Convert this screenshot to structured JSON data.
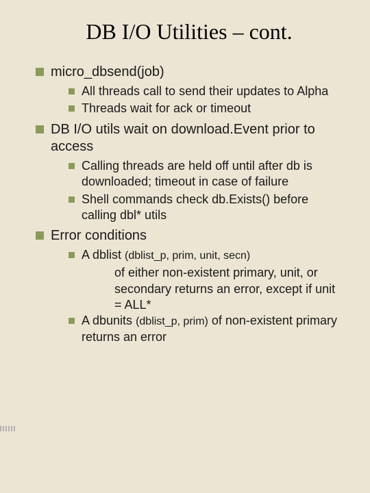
{
  "title": "DB I/O Utilities – cont.",
  "items": [
    {
      "text": "micro_dbsend(job)",
      "sub": [
        {
          "text": "All threads call to send their updates to Alpha"
        },
        {
          "text": "Threads wait for ack or timeout"
        }
      ]
    },
    {
      "text": "DB I/O utils wait on download.Event prior to access",
      "sub": [
        {
          "text": "Calling threads are held off until after db is downloaded; timeout in case of failure"
        },
        {
          "text": "Shell commands check db.Exists() before calling dbl* utils"
        }
      ]
    },
    {
      "text": "Error conditions",
      "sub": [
        {
          "text_a": "A dblist ",
          "text_b": "(dblist_p, prim, unit, secn)",
          "cont": "of either non-existent primary, unit, or secondary returns an error, except if unit = ALL*"
        },
        {
          "text_a": "A dbunits ",
          "text_b": "(dblist_p, prim)",
          "text_c": " of non-existent primary returns an error"
        }
      ]
    }
  ]
}
